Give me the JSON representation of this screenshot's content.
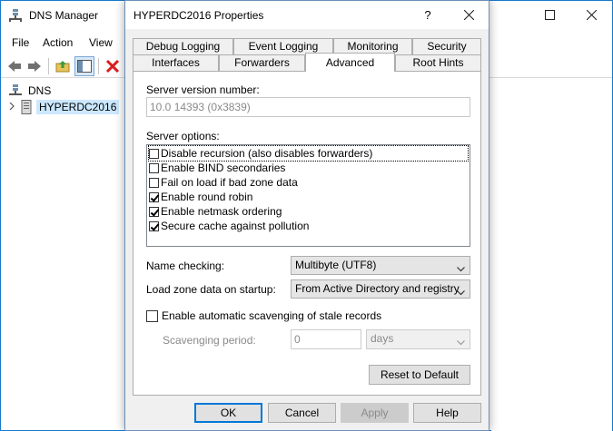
{
  "dns_manager": {
    "title": "DNS Manager",
    "menu": [
      "File",
      "Action",
      "View"
    ],
    "tree": {
      "root_label": "DNS",
      "server_label": "HYPERDC2016"
    }
  },
  "dialog": {
    "title": "HYPERDC2016 Properties",
    "help_glyph": "?",
    "close_glyph": "✕",
    "tabs_back": [
      "Debug Logging",
      "Event Logging",
      "Monitoring",
      "Security"
    ],
    "tabs_front": [
      "Interfaces",
      "Forwarders",
      "Advanced",
      "Root Hints"
    ],
    "active_tab": "Advanced",
    "version_label": "Server version number:",
    "version_value": "10.0 14393 (0x3839)",
    "options_label": "Server options:",
    "options": [
      {
        "label": "Disable recursion (also disables forwarders)",
        "checked": false
      },
      {
        "label": "Enable BIND secondaries",
        "checked": false
      },
      {
        "label": "Fail on load if bad zone data",
        "checked": false
      },
      {
        "label": "Enable round robin",
        "checked": true
      },
      {
        "label": "Enable netmask ordering",
        "checked": true
      },
      {
        "label": "Secure cache against pollution",
        "checked": true
      }
    ],
    "name_checking_label": "Name checking:",
    "name_checking_value": "Multibyte (UTF8)",
    "load_zone_label": "Load zone data on startup:",
    "load_zone_value": "From Active Directory and registry",
    "scavenging_label": "Enable automatic scavenging of stale records",
    "scavenging_checked": false,
    "scavenging_period_label": "Scavenging period:",
    "scavenging_period_value": "0",
    "scavenging_unit": "days",
    "reset_label": "Reset to Default",
    "ok_label": "OK",
    "cancel_label": "Cancel",
    "apply_label": "Apply",
    "help_label": "Help"
  },
  "colors": {
    "accent": "#0078d7",
    "window_border": "#1979ca",
    "dialog_bg": "#f0f0f0",
    "selected_tree": "#cce8ff"
  }
}
